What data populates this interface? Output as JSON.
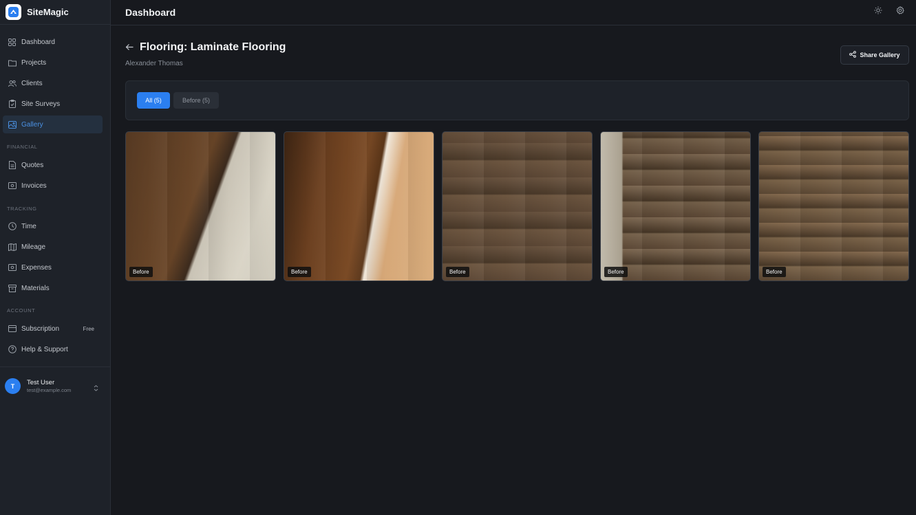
{
  "app": {
    "name": "SiteMagic"
  },
  "header": {
    "title": "Dashboard"
  },
  "sidebar": {
    "items": [
      {
        "label": "Dashboard",
        "icon": "dashboard-icon"
      },
      {
        "label": "Projects",
        "icon": "folder-icon"
      },
      {
        "label": "Clients",
        "icon": "users-icon"
      },
      {
        "label": "Site Surveys",
        "icon": "clipboard-icon"
      },
      {
        "label": "Gallery",
        "icon": "image-icon",
        "active": true
      }
    ],
    "sections": {
      "financial": "FINANCIAL",
      "tracking": "TRACKING",
      "account": "ACCOUNT"
    },
    "financial_items": [
      {
        "label": "Quotes",
        "icon": "file-icon"
      },
      {
        "label": "Invoices",
        "icon": "invoice-icon"
      }
    ],
    "tracking_items": [
      {
        "label": "Time",
        "icon": "clock-icon"
      },
      {
        "label": "Mileage",
        "icon": "map-icon"
      },
      {
        "label": "Expenses",
        "icon": "cash-icon"
      },
      {
        "label": "Materials",
        "icon": "box-icon"
      }
    ],
    "account_items": [
      {
        "label": "Subscription",
        "icon": "card-icon",
        "badge": "Free"
      },
      {
        "label": "Help & Support",
        "icon": "help-icon"
      }
    ],
    "user": {
      "initial": "T",
      "name": "Test User",
      "email": "test@example.com"
    }
  },
  "page": {
    "title": "Flooring: Laminate Flooring",
    "subtitle": "Alexander Thomas",
    "share_label": "Share Gallery",
    "tabs": [
      {
        "label": "All (5)",
        "active": true
      },
      {
        "label": "Before (5)",
        "active": false
      }
    ],
    "photos": [
      {
        "tag": "Before"
      },
      {
        "tag": "Before"
      },
      {
        "tag": "Before"
      },
      {
        "tag": "Before"
      },
      {
        "tag": "Before"
      }
    ]
  },
  "colors": {
    "accent": "#2b7ff0",
    "background": "#17191e",
    "sidebar": "#1e2229",
    "active_nav": "#24303f"
  }
}
